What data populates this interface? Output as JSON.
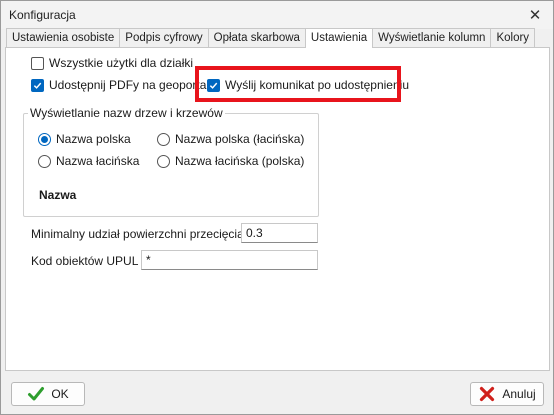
{
  "window": {
    "title": "Konfiguracja",
    "close_glyph": "✕"
  },
  "tabs": [
    {
      "label": "Ustawienia osobiste",
      "active": false
    },
    {
      "label": "Podpis cyfrowy",
      "active": false
    },
    {
      "label": "Opłata skarbowa",
      "active": false
    },
    {
      "label": "Ustawienia",
      "active": true
    },
    {
      "label": "Wyświetlanie kolumn",
      "active": false
    },
    {
      "label": "Kolory",
      "active": false
    }
  ],
  "options": {
    "all_uses": {
      "label": "Wszystkie użytki dla działki",
      "checked": false
    },
    "share_pdf": {
      "label": "Udostępnij PDFy na geoportalu",
      "checked": true
    },
    "send_message": {
      "label": "Wyślij komunikat po udostępnieniu",
      "checked": true
    }
  },
  "tree_names": {
    "legend": "Wyświetlanie nazw drzew i krzewów",
    "radios": [
      {
        "label": "Nazwa polska",
        "checked": true
      },
      {
        "label": "Nazwa polska (łacińska)",
        "checked": false
      },
      {
        "label": "Nazwa łacińska",
        "checked": false
      },
      {
        "label": "Nazwa łacińska (polska)",
        "checked": false
      }
    ],
    "preview": "Nazwa"
  },
  "fields": {
    "min_share": {
      "label": "Minimalny udział powierzchni przecięcia (%)",
      "value": "0.3"
    },
    "upul_codes": {
      "label": "Kod obiektów UPUL",
      "value": "*"
    }
  },
  "buttons": {
    "ok": {
      "label": "OK",
      "icon": "checkmark-icon"
    },
    "cancel": {
      "label": "Anuluj",
      "icon": "red-x-icon"
    }
  },
  "colors": {
    "accent": "#0067c0",
    "highlight": "#e8141c",
    "ok_icon": "#2e9e2e",
    "cancel_icon": "#d0201b"
  }
}
